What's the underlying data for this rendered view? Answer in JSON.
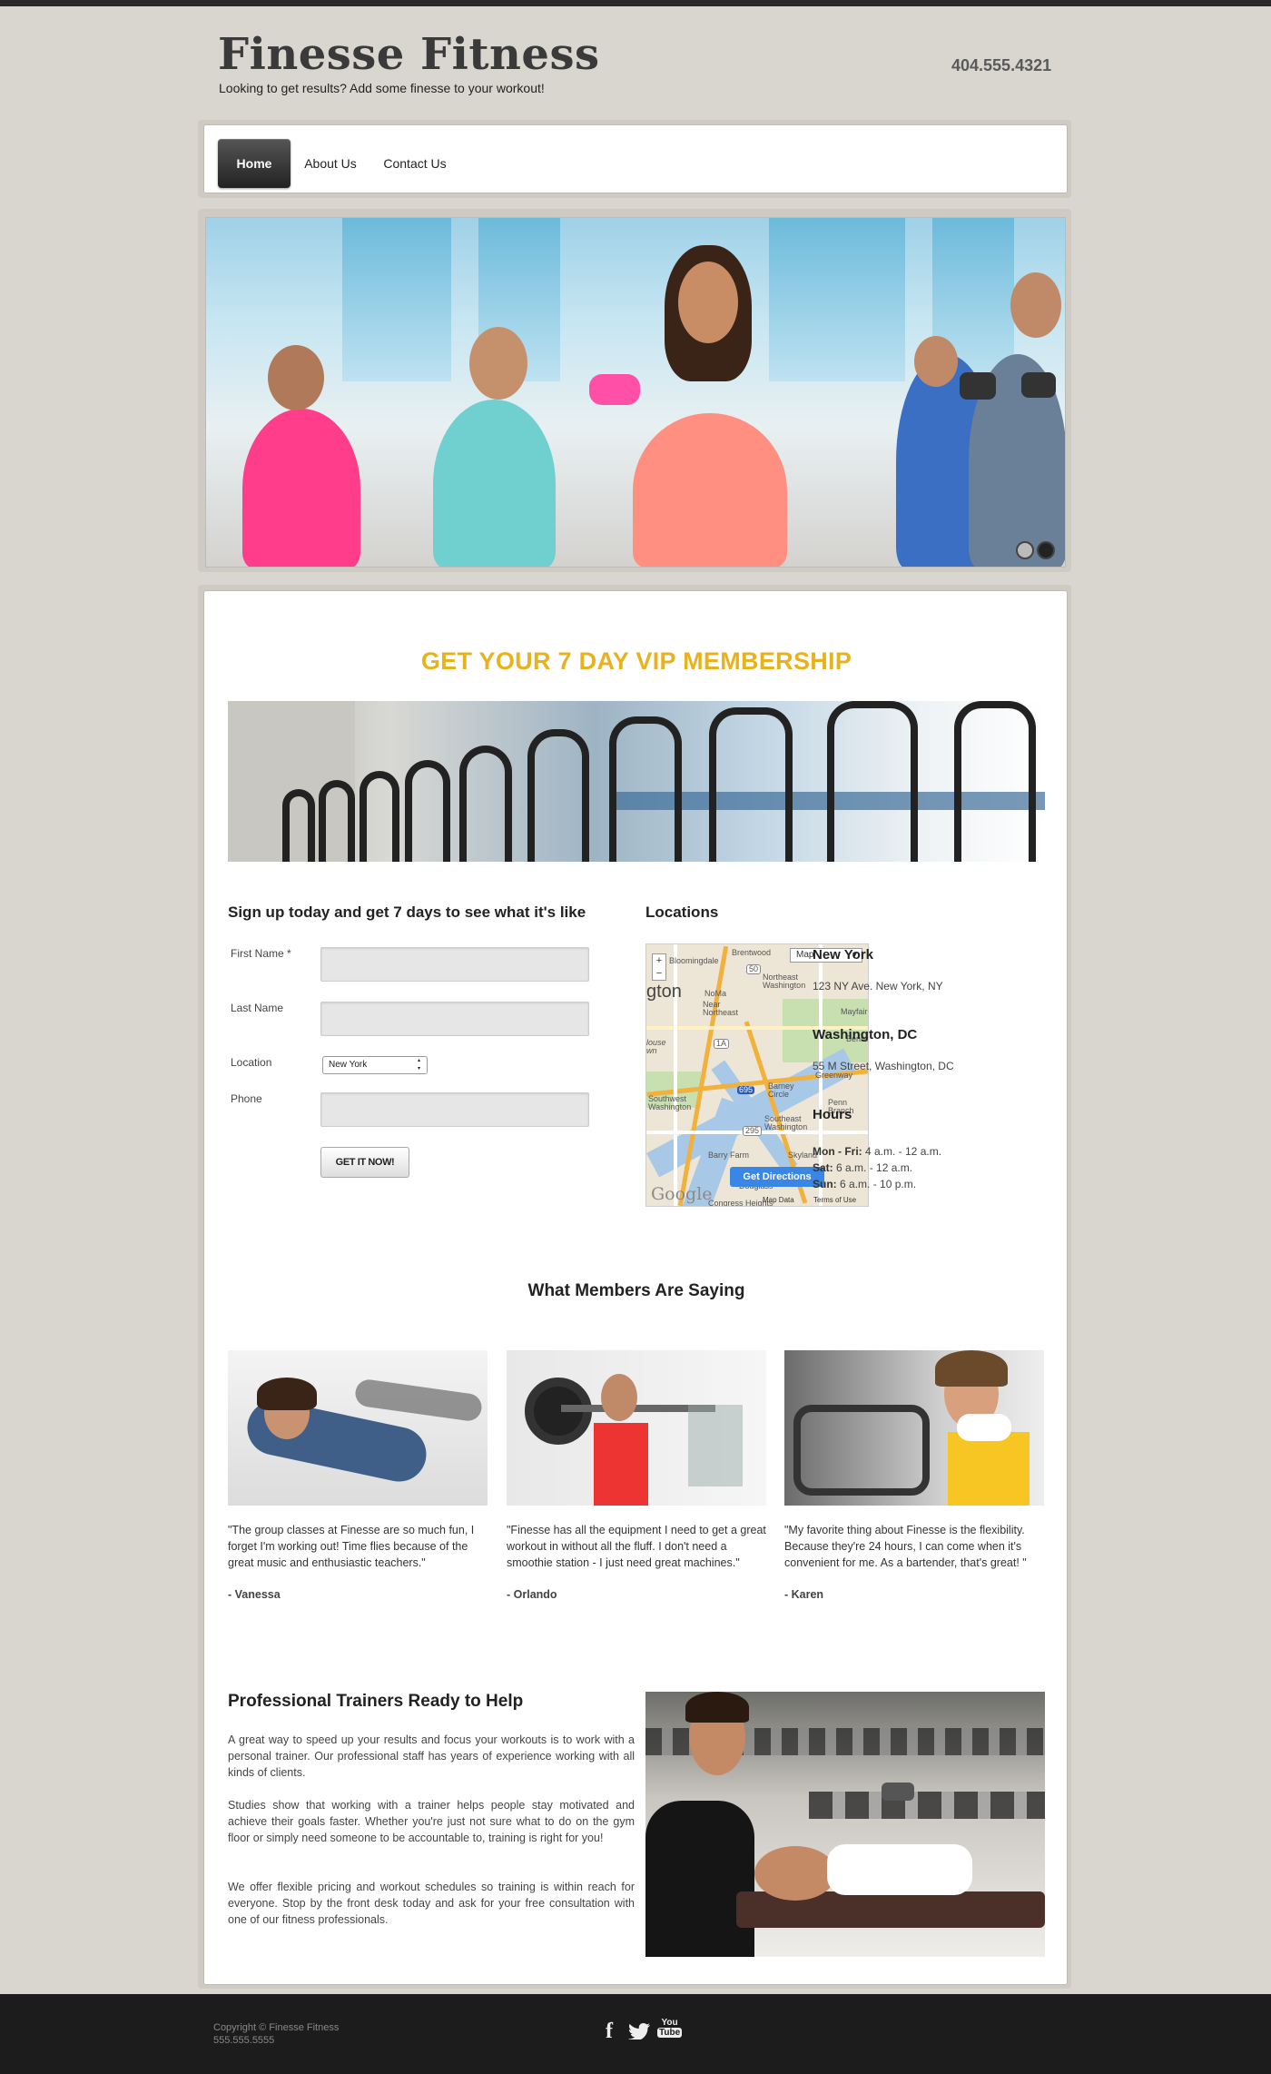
{
  "header": {
    "title": "Finesse Fitness",
    "tagline": "Looking to get results? Add some finesse to your workout!",
    "phone": "404.555.4321"
  },
  "nav": {
    "items": [
      {
        "label": "Home",
        "active": true
      },
      {
        "label": "About Us",
        "active": false
      },
      {
        "label": "Contact Us",
        "active": false
      }
    ]
  },
  "hero": {
    "slides_total": 2,
    "active_slide": 2
  },
  "promo": {
    "title": "GET YOUR 7 DAY VIP MEMBERSHIP"
  },
  "signup": {
    "heading": "Sign up today and get 7 days to see what it's like",
    "fields": {
      "first_name_label": "First Name *",
      "last_name_label": "Last Name",
      "location_label": "Location",
      "location_value": "New York",
      "phone_label": "Phone"
    },
    "submit_label": "GET IT NOW!"
  },
  "locations": {
    "heading": "Locations",
    "map": {
      "type_label": "Map",
      "zoom_in": "+",
      "zoom_out": "−",
      "directions_label": "Get Directions",
      "provider": "Google",
      "map_data": "Map Data",
      "terms": "Terms of Use",
      "labels": [
        "Brentwood",
        "Bloomingdale",
        "Northeast Washington",
        "NoMa",
        "Near Northeast",
        "Mayfair",
        "Benning",
        "Greenway",
        "Barney Circle",
        "Penn Branch",
        "Southwest Washington",
        "Southeast Washington",
        "Skyland",
        "Barry Farm",
        "Congress Heights",
        "Douglass",
        "gton",
        "louse wn",
        "50",
        "1A",
        "295",
        "695"
      ]
    },
    "new_york": {
      "title": "New York",
      "address": "123 NY Ave. New York, NY"
    },
    "washington": {
      "title": "Washington, DC",
      "address": "55 M Street, Washington, DC"
    },
    "hours": {
      "title": "Hours",
      "rows": [
        {
          "day": "Mon - Fri:",
          "time": "4 a.m. - 12 a.m."
        },
        {
          "day": "Sat:",
          "time": "6 a.m. - 12 a.m."
        },
        {
          "day": "Sun:",
          "time": "6 a.m. - 10 p.m."
        }
      ]
    }
  },
  "testimonials": {
    "heading": "What Members Are Saying",
    "items": [
      {
        "quote": "\"The group classes at Finesse are so much fun, I forget I'm working out! Time flies because of the great music and enthusiastic teachers.\"",
        "name": "- Vanessa"
      },
      {
        "quote": "\"Finesse has all the equipment I need to get a great workout in without all the fluff. I don't need a smoothie station - I just need great machines.\"",
        "name": "- Orlando"
      },
      {
        "quote": "\"My favorite thing about Finesse is the flexibility. Because they're 24 hours, I can come when it's convenient for me. As a bartender, that's great! \"",
        "name": "- Karen"
      }
    ]
  },
  "trainers": {
    "heading": "Professional Trainers Ready to Help",
    "paragraphs": [
      "A great way to speed up your results and focus your workouts is to work with a personal trainer. Our professional staff has years of experience working with all kinds of clients.",
      "Studies show that working with a trainer helps people stay motivated and achieve their goals faster. Whether you're just not sure what to do on the gym floor or simply need someone to be accountable to, training is right for you!",
      "We offer flexible pricing and workout schedules so training is within reach for everyone. Stop by the front desk today and ask for your free consultation with one of our fitness professionals."
    ]
  },
  "footer": {
    "copyright": "Copyright © Finesse Fitness",
    "phone": "555.555.5555",
    "social": {
      "facebook": "f",
      "twitter": "twitter-icon",
      "youtube_top": "You",
      "youtube_bottom": "Tube"
    }
  },
  "colors": {
    "accent": "#e8b21f",
    "background": "#d9d6cf",
    "footer": "#1c1c1c",
    "directions_button": "#3a86e4"
  }
}
